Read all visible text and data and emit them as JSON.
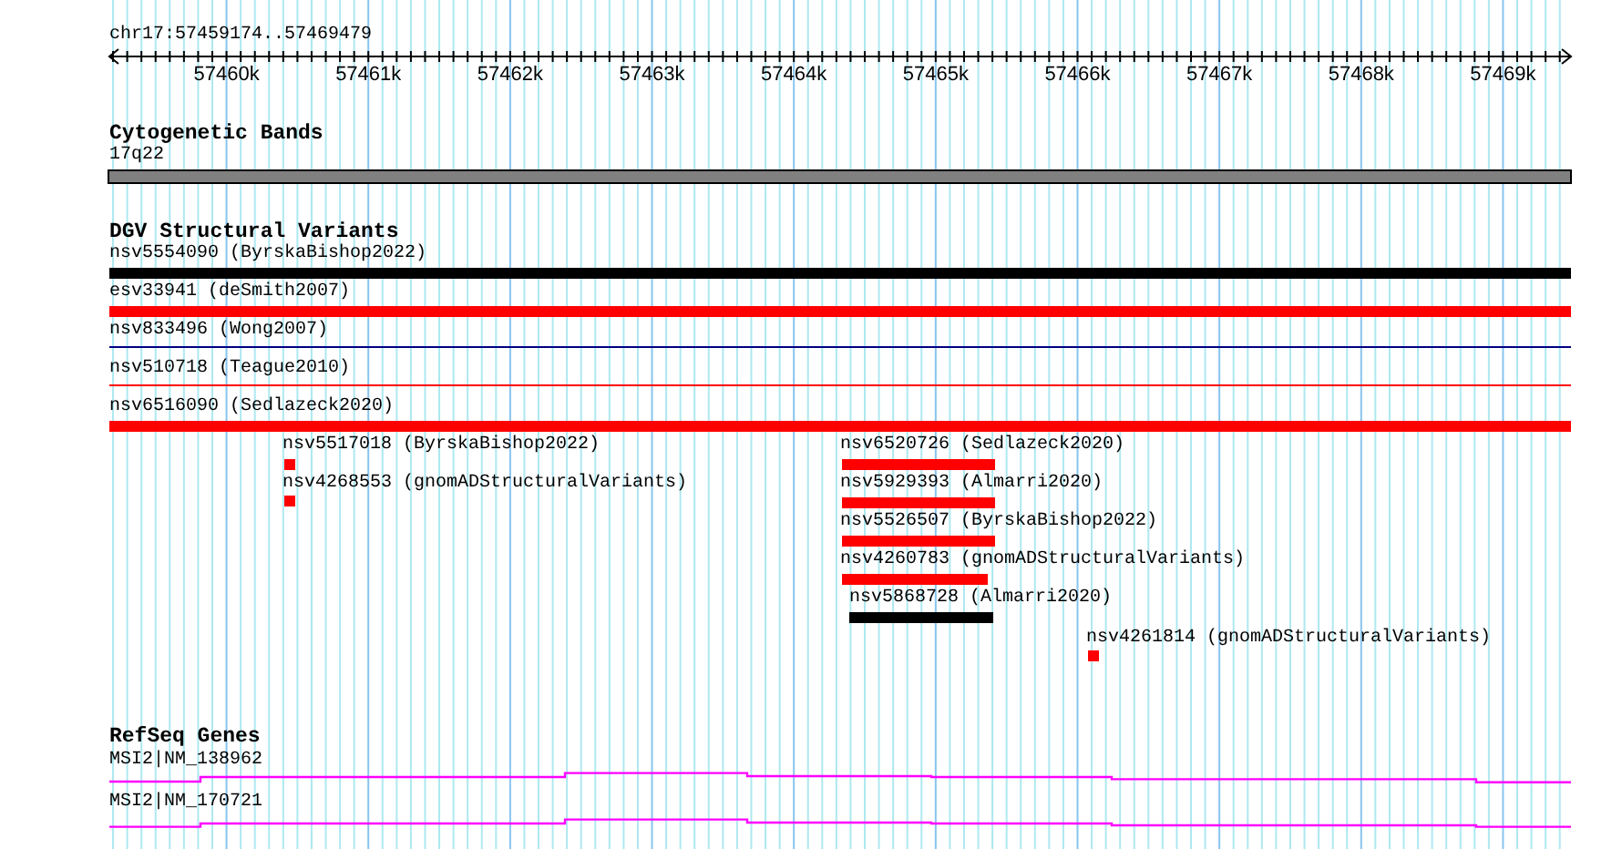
{
  "location": "chr17:57459174..57469479",
  "ruler": {
    "ticks": [
      "57460k",
      "57461k",
      "57462k",
      "57463k",
      "57464k",
      "57465k",
      "57466k",
      "57467k",
      "57468k",
      "57469k"
    ]
  },
  "tracks": [
    {
      "kind": "bands",
      "title": "Cytogenetic Bands",
      "features": [
        {
          "label": "17q22"
        }
      ]
    },
    {
      "kind": "variants",
      "title": "DGV Structural Variants",
      "features": [
        {
          "label": "nsv5554090 (ByrskaBishop2022)",
          "kind": "thick",
          "color": "#000000"
        },
        {
          "label": "esv33941 (deSmith2007)",
          "kind": "thick",
          "color": "#ff0000"
        },
        {
          "label": "nsv833496 (Wong2007)",
          "kind": "thin",
          "color": "#000080"
        },
        {
          "label": "nsv510718 (Teague2010)",
          "kind": "thin",
          "color": "#ff0000"
        },
        {
          "label": "nsv6516090 (Sedlazeck2020)",
          "kind": "thick",
          "color": "#ff0000"
        },
        {
          "label": "nsv5517018 (ByrskaBishop2022)",
          "kind": "thick",
          "color": "#ff0000"
        },
        {
          "label": "nsv4268553 (gnomADStructuralVariants)",
          "kind": "thick",
          "color": "#ff0000"
        },
        {
          "label": "nsv6520726 (Sedlazeck2020)",
          "kind": "thick",
          "color": "#ff0000"
        },
        {
          "label": "nsv5929393 (Almarri2020)",
          "kind": "thick",
          "color": "#ff0000"
        },
        {
          "label": "nsv5526507 (ByrskaBishop2022)",
          "kind": "thick",
          "color": "#ff0000"
        },
        {
          "label": "nsv4260783 (gnomADStructuralVariants)",
          "kind": "thick",
          "color": "#ff0000"
        },
        {
          "label": "nsv5868728 (Almarri2020)",
          "kind": "thick",
          "color": "#000000"
        },
        {
          "label": "nsv4261814 (gnomADStructuralVariants)",
          "kind": "thick",
          "color": "#ff0000"
        }
      ]
    },
    {
      "kind": "genes",
      "title": "RefSeq Genes",
      "features": [
        {
          "label": "MSI2|NM_138962"
        },
        {
          "label": "MSI2|NM_170721"
        }
      ]
    }
  ]
}
